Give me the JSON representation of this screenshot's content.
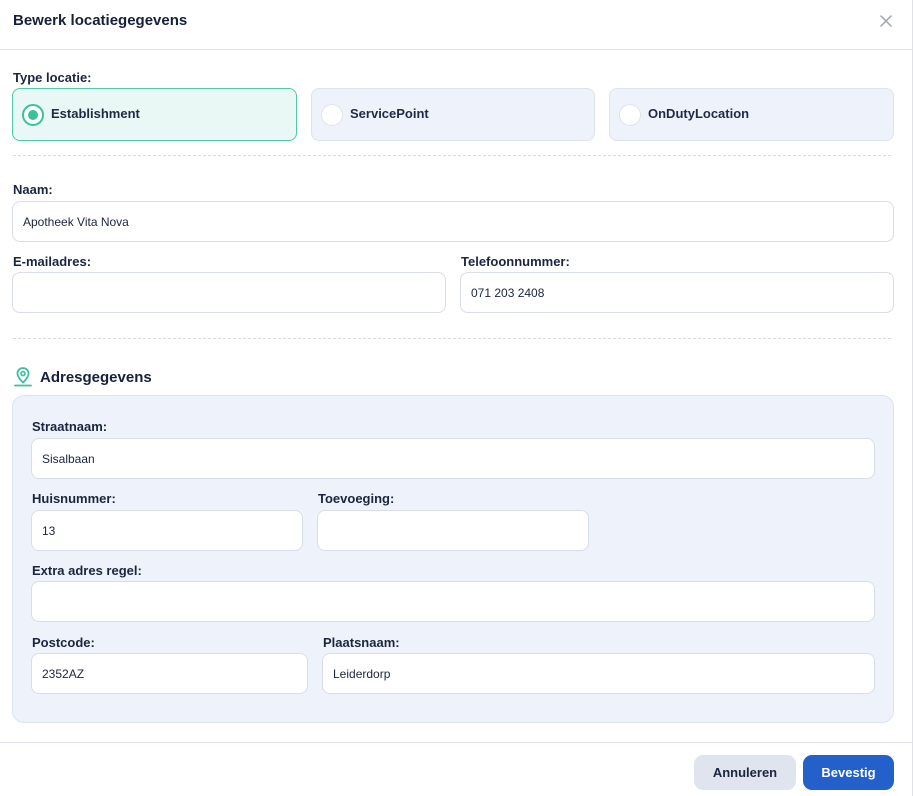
{
  "dialog": {
    "title": "Bewerk locatiegegevens"
  },
  "location_type": {
    "label": "Type locatie:",
    "options": [
      {
        "label": "Establishment",
        "selected": true
      },
      {
        "label": "ServicePoint",
        "selected": false
      },
      {
        "label": "OnDutyLocation",
        "selected": false
      }
    ]
  },
  "contact": {
    "name_label": "Naam:",
    "name_value": "Apotheek Vita Nova",
    "email_label": "E-mailadres:",
    "email_value": "",
    "phone_label": "Telefoonnummer:",
    "phone_value": "071 203 2408"
  },
  "address": {
    "section_title": "Adresgegevens",
    "street_label": "Straatnaam:",
    "street_value": "Sisalbaan",
    "housenumber_label": "Huisnummer:",
    "housenumber_value": "13",
    "addition_label": "Toevoeging:",
    "addition_value": "",
    "extra_label": "Extra adres regel:",
    "extra_value": "",
    "postcode_label": "Postcode:",
    "postcode_value": "2352AZ",
    "city_label": "Plaatsnaam:",
    "city_value": "Leiderdorp"
  },
  "footer": {
    "cancel_label": "Annuleren",
    "confirm_label": "Bevestig"
  },
  "colors": {
    "accent": "#39c29b",
    "primary": "#2360c9",
    "panel": "#eef2fa"
  }
}
